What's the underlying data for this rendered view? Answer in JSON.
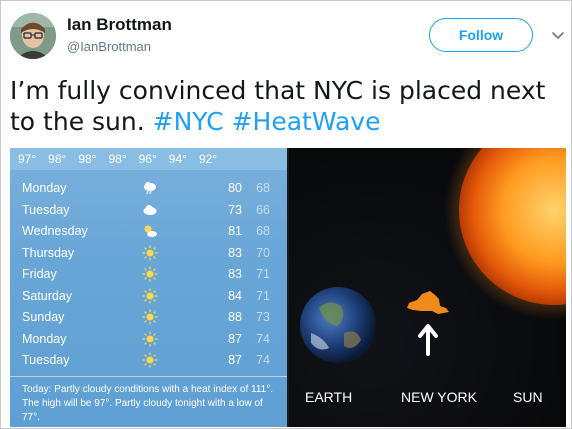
{
  "user": {
    "name": "Ian Brottman",
    "handle": "@IanBrottman",
    "follow_label": "Follow"
  },
  "tweet": {
    "text_part1": "I’m fully convinced that NYC is placed next to the sun. ",
    "hashtag1": "#NYC",
    "space": " ",
    "hashtag2": "#HeatWave"
  },
  "weather": {
    "hourly_temps": [
      "97°",
      "98°",
      "98°",
      "98°",
      "96°",
      "94°",
      "92°"
    ],
    "days": [
      {
        "name": "Monday",
        "icon": "rain-cloud-icon",
        "high": "80",
        "low": "68"
      },
      {
        "name": "Tuesday",
        "icon": "cloud-icon",
        "high": "73",
        "low": "66"
      },
      {
        "name": "Wednesday",
        "icon": "partly-cloudy-icon",
        "high": "81",
        "low": "68"
      },
      {
        "name": "Thursday",
        "icon": "sun-icon",
        "high": "83",
        "low": "70"
      },
      {
        "name": "Friday",
        "icon": "sun-icon",
        "high": "83",
        "low": "71"
      },
      {
        "name": "Saturday",
        "icon": "sun-icon",
        "high": "84",
        "low": "71"
      },
      {
        "name": "Sunday",
        "icon": "sun-icon",
        "high": "88",
        "low": "73"
      },
      {
        "name": "Monday",
        "icon": "sun-icon",
        "high": "87",
        "low": "74"
      },
      {
        "name": "Tuesday",
        "icon": "sun-icon",
        "high": "87",
        "low": "74"
      }
    ],
    "summary": "Today: Partly cloudy conditions with a heat index of 111°. The high will be 97°. Partly cloudy tonight with a low of 77°."
  },
  "space_image": {
    "label_earth": "EARTH",
    "label_new_york": "NEW YORK",
    "label_sun": "SUN"
  },
  "colors": {
    "accent": "#1da1f2",
    "nyc_orange": "#f08a1c"
  }
}
